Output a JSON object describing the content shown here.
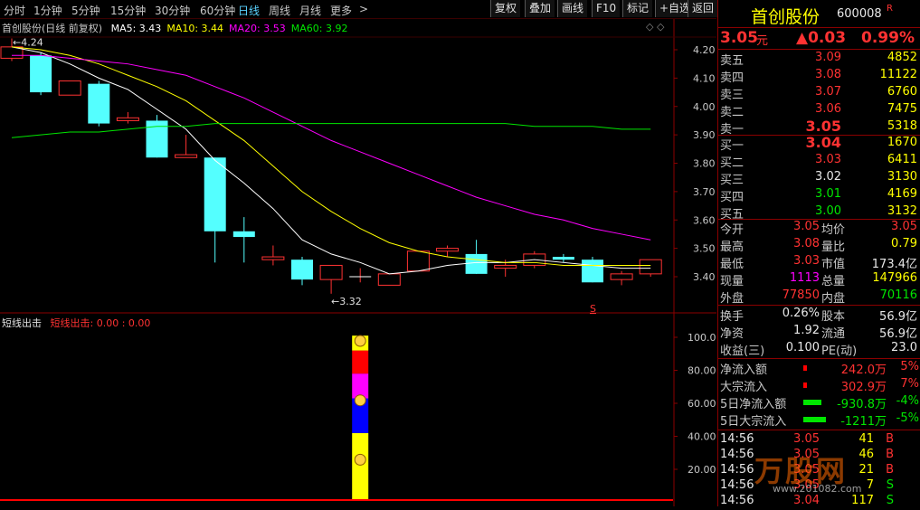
{
  "toolbar": {
    "periods": [
      "分时",
      "1分钟",
      "5分钟",
      "15分钟",
      "30分钟",
      "60分钟",
      "日线",
      "周线",
      "月线",
      "更多"
    ],
    "active_period": "日线",
    "more_arrow": ">",
    "buttons": [
      "复权",
      "叠加",
      "画线",
      "F10",
      "标记",
      "+自选",
      "返回"
    ]
  },
  "main_chart": {
    "title": "首创股份(日线 前复权)",
    "ma_labels": [
      {
        "text": "MA5: 3.43",
        "color": "#ffffff"
      },
      {
        "text": "MA10: 3.44",
        "color": "#ffff00"
      },
      {
        "text": "MA20: 3.53",
        "color": "#ff00ff"
      },
      {
        "text": "MA60: 3.92",
        "color": "#00e600"
      }
    ],
    "high_marker": "4.24",
    "low_marker": "3.32",
    "s_marker": "S",
    "diamond": "◇ ◇"
  },
  "chart_data": [
    {
      "type": "candlestick",
      "ylim": [
        3.33,
        4.26
      ],
      "y_ticks": [
        "4.20",
        "4.10",
        "4.00",
        "3.90",
        "3.80",
        "3.70",
        "3.60",
        "3.50",
        "3.40"
      ],
      "candles": [
        {
          "o": 4.17,
          "c": 4.21,
          "h": 4.24,
          "l": 4.16
        },
        {
          "o": 4.18,
          "c": 4.05,
          "h": 4.19,
          "l": 4.04
        },
        {
          "o": 4.04,
          "c": 4.09,
          "h": 4.09,
          "l": 4.04
        },
        {
          "o": 4.08,
          "c": 3.94,
          "h": 4.09,
          "l": 3.93
        },
        {
          "o": 3.95,
          "c": 3.96,
          "h": 3.98,
          "l": 3.94
        },
        {
          "o": 3.95,
          "c": 3.82,
          "h": 3.97,
          "l": 3.82
        },
        {
          "o": 3.82,
          "c": 3.83,
          "h": 3.9,
          "l": 3.82
        },
        {
          "o": 3.82,
          "c": 3.56,
          "h": 3.82,
          "l": 3.45
        },
        {
          "o": 3.56,
          "c": 3.54,
          "h": 3.61,
          "l": 3.45
        },
        {
          "o": 3.46,
          "c": 3.47,
          "h": 3.51,
          "l": 3.44
        },
        {
          "o": 3.46,
          "c": 3.39,
          "h": 3.47,
          "l": 3.37
        },
        {
          "o": 3.39,
          "c": 3.44,
          "h": 3.44,
          "l": 3.34
        },
        {
          "o": 3.4,
          "c": 3.4,
          "h": 3.43,
          "l": 3.38
        },
        {
          "o": 3.37,
          "c": 3.41,
          "h": 3.41,
          "l": 3.37
        },
        {
          "o": 3.42,
          "c": 3.49,
          "h": 3.49,
          "l": 3.42
        },
        {
          "o": 3.49,
          "c": 3.5,
          "h": 3.51,
          "l": 3.47
        },
        {
          "o": 3.48,
          "c": 3.41,
          "h": 3.53,
          "l": 3.41
        },
        {
          "o": 3.43,
          "c": 3.44,
          "h": 3.46,
          "l": 3.4
        },
        {
          "o": 3.44,
          "c": 3.48,
          "h": 3.49,
          "l": 3.43
        },
        {
          "o": 3.47,
          "c": 3.46,
          "h": 3.48,
          "l": 3.45
        },
        {
          "o": 3.46,
          "c": 3.38,
          "h": 3.47,
          "l": 3.38
        },
        {
          "o": 3.39,
          "c": 3.41,
          "h": 3.42,
          "l": 3.37
        },
        {
          "o": 3.41,
          "c": 3.46,
          "h": 3.46,
          "l": 3.4
        }
      ],
      "series": [
        {
          "name": "MA5",
          "color": "#ffffff",
          "values": [
            4.21,
            4.19,
            4.15,
            4.1,
            4.06,
            3.99,
            3.92,
            3.81,
            3.73,
            3.64,
            3.53,
            3.48,
            3.45,
            3.41,
            3.42,
            3.44,
            3.45,
            3.45,
            3.46,
            3.45,
            3.44,
            3.43,
            3.43
          ]
        },
        {
          "name": "MA10",
          "color": "#ffff00",
          "values": [
            4.21,
            4.2,
            4.18,
            4.15,
            4.11,
            4.07,
            4.02,
            3.95,
            3.88,
            3.79,
            3.7,
            3.63,
            3.57,
            3.52,
            3.49,
            3.47,
            3.46,
            3.45,
            3.45,
            3.44,
            3.44,
            3.44,
            3.44
          ]
        },
        {
          "name": "MA20",
          "color": "#ff00ff",
          "values": [
            4.18,
            4.18,
            4.17,
            4.16,
            4.15,
            4.13,
            4.11,
            4.07,
            4.03,
            3.98,
            3.93,
            3.88,
            3.84,
            3.8,
            3.76,
            3.72,
            3.68,
            3.65,
            3.62,
            3.6,
            3.57,
            3.55,
            3.53
          ]
        },
        {
          "name": "MA60",
          "color": "#00e600",
          "values": [
            3.89,
            3.9,
            3.91,
            3.91,
            3.92,
            3.93,
            3.93,
            3.94,
            3.94,
            3.94,
            3.94,
            3.94,
            3.94,
            3.94,
            3.94,
            3.94,
            3.94,
            3.94,
            3.93,
            3.93,
            3.93,
            3.92,
            3.92
          ]
        }
      ]
    },
    {
      "type": "bar",
      "title": "短线出击",
      "legend": "短线出击: 0.00 : 0.00",
      "ylim": [
        0,
        110
      ],
      "y_ticks": [
        "100.0",
        "80.00",
        "60.00",
        "40.00",
        "20.00"
      ],
      "bar_index": 12,
      "segments": [
        {
          "from": 0,
          "to": 42,
          "color": "#ffff00"
        },
        {
          "from": 42,
          "to": 63,
          "color": "#0000ff"
        },
        {
          "from": 63,
          "to": 78,
          "color": "#ff00ff"
        },
        {
          "from": 78,
          "to": 92,
          "color": "#ff0000"
        },
        {
          "from": 92,
          "to": 101,
          "color": "#ffff00"
        }
      ],
      "baseline_color": "#ff0000"
    }
  ],
  "panel": {
    "name": "首创股份",
    "code": "600008",
    "r_mark": "R",
    "price": "3.05",
    "price_unit": "元",
    "change": "▲0.03",
    "change_pct": "0.99%",
    "sells": [
      {
        "label": "卖五",
        "price": "3.09",
        "vol": "4852"
      },
      {
        "label": "卖四",
        "price": "3.08",
        "vol": "11122"
      },
      {
        "label": "卖三",
        "price": "3.07",
        "vol": "6760"
      },
      {
        "label": "卖二",
        "price": "3.06",
        "vol": "7475"
      },
      {
        "label": "卖一",
        "price": "3.05",
        "vol": "5318"
      }
    ],
    "buys": [
      {
        "label": "买一",
        "price": "3.04",
        "vol": "1670"
      },
      {
        "label": "买二",
        "price": "3.03",
        "vol": "6411"
      },
      {
        "label": "买三",
        "price": "3.02",
        "vol": "3130"
      },
      {
        "label": "买四",
        "price": "3.01",
        "vol": "4169"
      },
      {
        "label": "买五",
        "price": "3.00",
        "vol": "3132"
      }
    ],
    "stats1": [
      {
        "l1": "今开",
        "v1": "3.05",
        "l2": "均价",
        "v2": "3.05"
      },
      {
        "l1": "最高",
        "v1": "3.08",
        "l2": "量比",
        "v2": "0.79"
      },
      {
        "l1": "最低",
        "v1": "3.03",
        "l2": "市值",
        "v2": "173.4亿"
      },
      {
        "l1": "现量",
        "v1": "1113",
        "l2": "总量",
        "v2": "147966"
      },
      {
        "l1": "外盘",
        "v1": "77850",
        "l2": "内盘",
        "v2": "70116"
      }
    ],
    "stats2": [
      {
        "l1": "换手",
        "v1": "0.26%",
        "l2": "股本",
        "v2": "56.9亿"
      },
      {
        "l1": "净资",
        "v1": "1.92",
        "l2": "流通",
        "v2": "56.9亿"
      },
      {
        "l1": "收益(三)",
        "v1": "0.100",
        "l2": "PE(动)",
        "v2": "23.0"
      }
    ],
    "flows": [
      {
        "label": "净流入额",
        "value": "242.0万",
        "pct": "5%",
        "bar_color": "#ff0000",
        "bar_frac": 0.05
      },
      {
        "label": "大宗流入",
        "value": "302.9万",
        "pct": "7%",
        "bar_color": "#ff0000",
        "bar_frac": 0.07
      },
      {
        "label": "5日净流入额",
        "value": "-930.8万",
        "pct": "-4%",
        "bar_color": "#00e600",
        "bar_frac": 0.4
      },
      {
        "label": "5日大宗流入",
        "value": "-1211万",
        "pct": "-5%",
        "bar_color": "#00e600",
        "bar_frac": 0.5
      }
    ],
    "ticks": [
      {
        "time": "14:56",
        "price": "3.05",
        "vol": "41",
        "side": "B"
      },
      {
        "time": "14:56",
        "price": "3.05",
        "vol": "46",
        "side": "B"
      },
      {
        "time": "14:56",
        "price": "3.05",
        "vol": "21",
        "side": "B"
      },
      {
        "time": "14:56",
        "price": "3.05",
        "vol": "7",
        "side": "S"
      },
      {
        "time": "14:56",
        "price": "3.04",
        "vol": "117",
        "side": "S"
      }
    ],
    "watermark": "万股网",
    "watermark_url": "www.201082.com"
  }
}
